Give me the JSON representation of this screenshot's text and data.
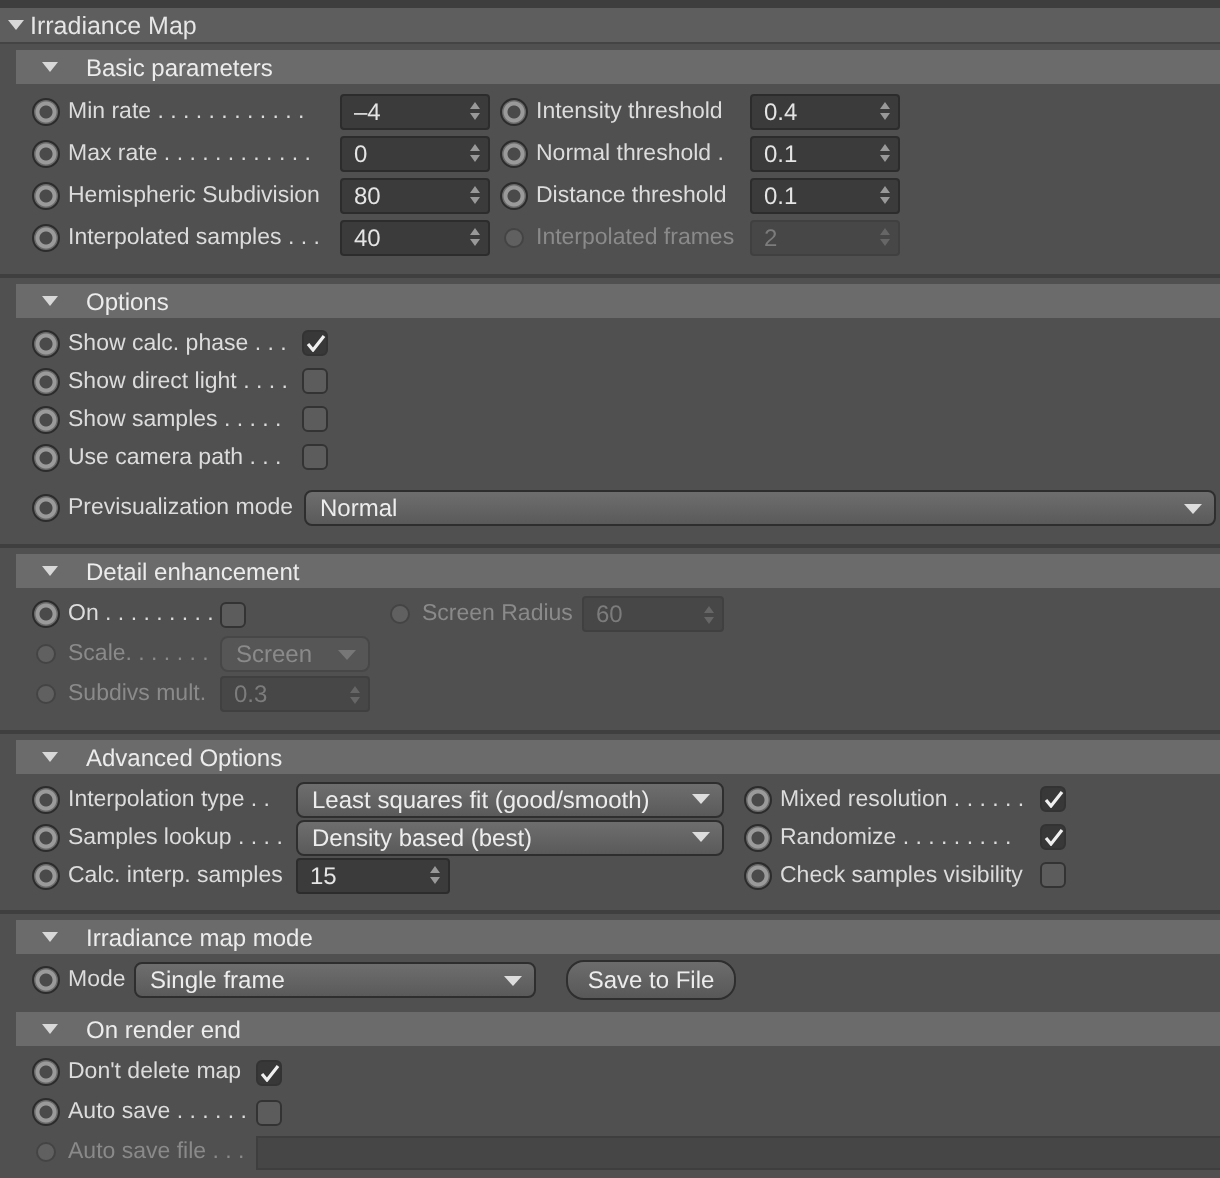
{
  "panel": {
    "title": "Irradiance Map",
    "expanded": true
  },
  "sections": [
    {
      "title": "Basic parameters",
      "expanded": true,
      "rows": [
        [
          {
            "kind": "spinner",
            "label": "Min rate . . . . . . . . . . . .",
            "value": "–4",
            "disabled": false
          },
          {
            "kind": "spinner",
            "label": "Intensity threshold",
            "value": "0.4",
            "disabled": false
          }
        ],
        [
          {
            "kind": "spinner",
            "label": "Max rate . . . . . . . . . . . .",
            "value": "0",
            "disabled": false
          },
          {
            "kind": "spinner",
            "label": "Normal threshold .",
            "value": "0.1",
            "disabled": false
          }
        ],
        [
          {
            "kind": "spinner",
            "label": "Hemispheric Subdivision",
            "value": "80",
            "disabled": false
          },
          {
            "kind": "spinner",
            "label": "Distance threshold",
            "value": "0.1",
            "disabled": false
          }
        ],
        [
          {
            "kind": "spinner",
            "label": "Interpolated samples . . .",
            "value": "40",
            "disabled": false
          },
          {
            "kind": "spinner",
            "label": "Interpolated frames",
            "value": "2",
            "disabled": true
          }
        ]
      ]
    },
    {
      "title": "Options",
      "expanded": true,
      "rows": [
        [
          {
            "kind": "checkbox",
            "label": "Show calc. phase . . .",
            "checked": true,
            "disabled": false
          }
        ],
        [
          {
            "kind": "checkbox",
            "label": "Show direct light . . . .",
            "checked": false,
            "disabled": false
          }
        ],
        [
          {
            "kind": "checkbox",
            "label": "Show samples . . . . .",
            "checked": false,
            "disabled": false
          }
        ],
        [
          {
            "kind": "checkbox",
            "label": "Use camera path . . .",
            "checked": false,
            "disabled": false
          }
        ],
        [
          {
            "kind": "dropdown",
            "label": "Previsualization mode",
            "value": "Normal",
            "disabled": false
          }
        ]
      ]
    },
    {
      "title": "Detail enhancement",
      "expanded": true,
      "rows": [
        [
          {
            "kind": "checkbox",
            "label": "On . . . . . . . . .",
            "checked": false,
            "disabled": false
          },
          {
            "kind": "spinner",
            "label": "Screen Radius",
            "value": "60",
            "disabled": true
          }
        ],
        [
          {
            "kind": "dropdown",
            "label": "Scale. . . . . . .",
            "value": "Screen",
            "disabled": true
          }
        ],
        [
          {
            "kind": "spinner",
            "label": "Subdivs mult.",
            "value": "0.3",
            "disabled": true
          }
        ]
      ]
    },
    {
      "title": "Advanced Options",
      "expanded": true,
      "rows": [
        [
          {
            "kind": "dropdown",
            "label": "Interpolation type . .",
            "value": "Least squares fit (good/smooth)",
            "disabled": false
          },
          {
            "kind": "checkbox",
            "label": "Mixed resolution . . . . . .",
            "checked": true,
            "disabled": false
          }
        ],
        [
          {
            "kind": "dropdown",
            "label": "Samples lookup . . . .",
            "value": "Density based (best)",
            "disabled": false
          },
          {
            "kind": "checkbox",
            "label": "Randomize . . . . . . . . .",
            "checked": true,
            "disabled": false
          }
        ],
        [
          {
            "kind": "spinner",
            "label": "Calc. interp. samples",
            "value": "15",
            "disabled": false
          },
          {
            "kind": "checkbox",
            "label": "Check samples visibility",
            "checked": false,
            "disabled": false
          }
        ]
      ]
    },
    {
      "title": "Irradiance map mode",
      "expanded": true,
      "rows": [
        [
          {
            "kind": "dropdown",
            "label": "Mode",
            "value": "Single frame",
            "disabled": false
          },
          {
            "kind": "button",
            "label": "Save to File",
            "disabled": false
          }
        ]
      ]
    },
    {
      "title": "On render end",
      "expanded": true,
      "rows": [
        [
          {
            "kind": "checkbox",
            "label": "Don't delete map",
            "checked": true,
            "disabled": false
          }
        ],
        [
          {
            "kind": "checkbox",
            "label": "Auto save . . . . . .",
            "checked": false,
            "disabled": false
          }
        ],
        [
          {
            "kind": "textfield",
            "label": "Auto save file . . .",
            "disabled": true
          }
        ]
      ]
    }
  ]
}
